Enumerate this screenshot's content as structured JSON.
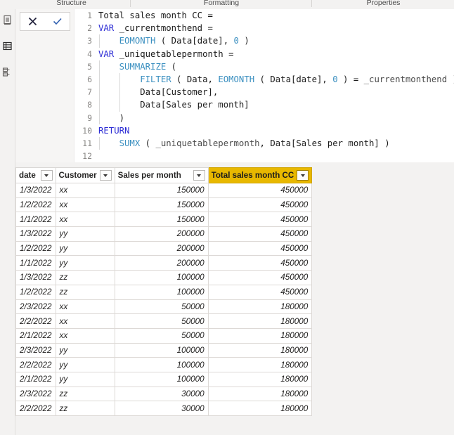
{
  "ribbon": {
    "groups": [
      {
        "label": "Structure"
      },
      {
        "label": "Formatting"
      },
      {
        "label": "Properties"
      }
    ]
  },
  "nav_rail": {
    "items": [
      {
        "name": "report-view",
        "label": "Report view"
      },
      {
        "name": "data-view",
        "label": "Data view"
      },
      {
        "name": "model-view",
        "label": "Model view"
      }
    ]
  },
  "formula_bar": {
    "cancel_label": "Cancel",
    "commit_label": "Commit",
    "lines": [
      {
        "number": "1",
        "indent": 0,
        "tokens": [
          {
            "text": "Total sales month CC =",
            "cls": "tok-plain"
          }
        ]
      },
      {
        "number": "2",
        "indent": 0,
        "tokens": [
          {
            "text": "VAR",
            "cls": "tok-kw"
          },
          {
            "text": " _currentmonthend =",
            "cls": "tok-plain"
          }
        ]
      },
      {
        "number": "3",
        "indent": 1,
        "tokens": [
          {
            "text": "    ",
            "cls": "tok-plain"
          },
          {
            "text": "EOMONTH",
            "cls": "tok-fn"
          },
          {
            "text": " ( ",
            "cls": "tok-punc"
          },
          {
            "text": "Data[date]",
            "cls": "tok-ref"
          },
          {
            "text": ", ",
            "cls": "tok-punc"
          },
          {
            "text": "0",
            "cls": "tok-num"
          },
          {
            "text": " )",
            "cls": "tok-punc"
          }
        ]
      },
      {
        "number": "4",
        "indent": 0,
        "tokens": [
          {
            "text": "VAR",
            "cls": "tok-kw"
          },
          {
            "text": " _uniquetablepermonth =",
            "cls": "tok-plain"
          }
        ]
      },
      {
        "number": "5",
        "indent": 1,
        "tokens": [
          {
            "text": "    ",
            "cls": "tok-plain"
          },
          {
            "text": "SUMMARIZE",
            "cls": "tok-fn"
          },
          {
            "text": " (",
            "cls": "tok-punc"
          }
        ]
      },
      {
        "number": "6",
        "indent": 2,
        "tokens": [
          {
            "text": "        ",
            "cls": "tok-plain"
          },
          {
            "text": "FILTER",
            "cls": "tok-fn"
          },
          {
            "text": " ( ",
            "cls": "tok-punc"
          },
          {
            "text": "Data",
            "cls": "tok-ref"
          },
          {
            "text": ", ",
            "cls": "tok-punc"
          },
          {
            "text": "EOMONTH",
            "cls": "tok-fn"
          },
          {
            "text": " ( ",
            "cls": "tok-punc"
          },
          {
            "text": "Data[date]",
            "cls": "tok-ref"
          },
          {
            "text": ", ",
            "cls": "tok-punc"
          },
          {
            "text": "0",
            "cls": "tok-num"
          },
          {
            "text": " ) = ",
            "cls": "tok-punc"
          },
          {
            "text": "_currentmonthend",
            "cls": "tok-var"
          },
          {
            "text": " ),",
            "cls": "tok-punc"
          }
        ]
      },
      {
        "number": "7",
        "indent": 2,
        "tokens": [
          {
            "text": "        ",
            "cls": "tok-plain"
          },
          {
            "text": "Data[Customer]",
            "cls": "tok-ref"
          },
          {
            "text": ",",
            "cls": "tok-punc"
          }
        ]
      },
      {
        "number": "8",
        "indent": 2,
        "tokens": [
          {
            "text": "        ",
            "cls": "tok-plain"
          },
          {
            "text": "Data[Sales per month]",
            "cls": "tok-ref"
          }
        ]
      },
      {
        "number": "9",
        "indent": 1,
        "tokens": [
          {
            "text": "    )",
            "cls": "tok-punc"
          }
        ]
      },
      {
        "number": "10",
        "indent": 0,
        "tokens": [
          {
            "text": "RETURN",
            "cls": "tok-kw"
          }
        ]
      },
      {
        "number": "11",
        "indent": 1,
        "tokens": [
          {
            "text": "    ",
            "cls": "tok-plain"
          },
          {
            "text": "SUMX",
            "cls": "tok-fn"
          },
          {
            "text": " ( ",
            "cls": "tok-punc"
          },
          {
            "text": "_uniquetablepermonth",
            "cls": "tok-var"
          },
          {
            "text": ", ",
            "cls": "tok-punc"
          },
          {
            "text": "Data[Sales per month]",
            "cls": "tok-ref"
          },
          {
            "text": " )",
            "cls": "tok-punc"
          }
        ]
      },
      {
        "number": "12",
        "indent": 0,
        "tokens": []
      }
    ]
  },
  "grid": {
    "columns": [
      {
        "label": "date",
        "highlight": false
      },
      {
        "label": "Customer",
        "highlight": false
      },
      {
        "label": "Sales per month",
        "highlight": false
      },
      {
        "label": "Total sales month CC",
        "highlight": true
      }
    ],
    "rows": [
      {
        "date": "1/3/2022",
        "customer": "xx",
        "sales_per_month": "150000",
        "total_sales_month_cc": "450000"
      },
      {
        "date": "1/2/2022",
        "customer": "xx",
        "sales_per_month": "150000",
        "total_sales_month_cc": "450000"
      },
      {
        "date": "1/1/2022",
        "customer": "xx",
        "sales_per_month": "150000",
        "total_sales_month_cc": "450000"
      },
      {
        "date": "1/3/2022",
        "customer": "yy",
        "sales_per_month": "200000",
        "total_sales_month_cc": "450000"
      },
      {
        "date": "1/2/2022",
        "customer": "yy",
        "sales_per_month": "200000",
        "total_sales_month_cc": "450000"
      },
      {
        "date": "1/1/2022",
        "customer": "yy",
        "sales_per_month": "200000",
        "total_sales_month_cc": "450000"
      },
      {
        "date": "1/3/2022",
        "customer": "zz",
        "sales_per_month": "100000",
        "total_sales_month_cc": "450000"
      },
      {
        "date": "1/2/2022",
        "customer": "zz",
        "sales_per_month": "100000",
        "total_sales_month_cc": "450000"
      },
      {
        "date": "2/3/2022",
        "customer": "xx",
        "sales_per_month": "50000",
        "total_sales_month_cc": "180000"
      },
      {
        "date": "2/2/2022",
        "customer": "xx",
        "sales_per_month": "50000",
        "total_sales_month_cc": "180000"
      },
      {
        "date": "2/1/2022",
        "customer": "xx",
        "sales_per_month": "50000",
        "total_sales_month_cc": "180000"
      },
      {
        "date": "2/3/2022",
        "customer": "yy",
        "sales_per_month": "100000",
        "total_sales_month_cc": "180000"
      },
      {
        "date": "2/2/2022",
        "customer": "yy",
        "sales_per_month": "100000",
        "total_sales_month_cc": "180000"
      },
      {
        "date": "2/1/2022",
        "customer": "yy",
        "sales_per_month": "100000",
        "total_sales_month_cc": "180000"
      },
      {
        "date": "2/3/2022",
        "customer": "zz",
        "sales_per_month": "30000",
        "total_sales_month_cc": "180000"
      },
      {
        "date": "2/2/2022",
        "customer": "zz",
        "sales_per_month": "30000",
        "total_sales_month_cc": "180000"
      }
    ]
  },
  "colors": {
    "highlight_header": "#e8b800",
    "computed_column_bg": "#ebe9e7",
    "keyword": "#2b2bd4",
    "function": "#3a8fc0",
    "app_bg": "#f3f2f1"
  }
}
